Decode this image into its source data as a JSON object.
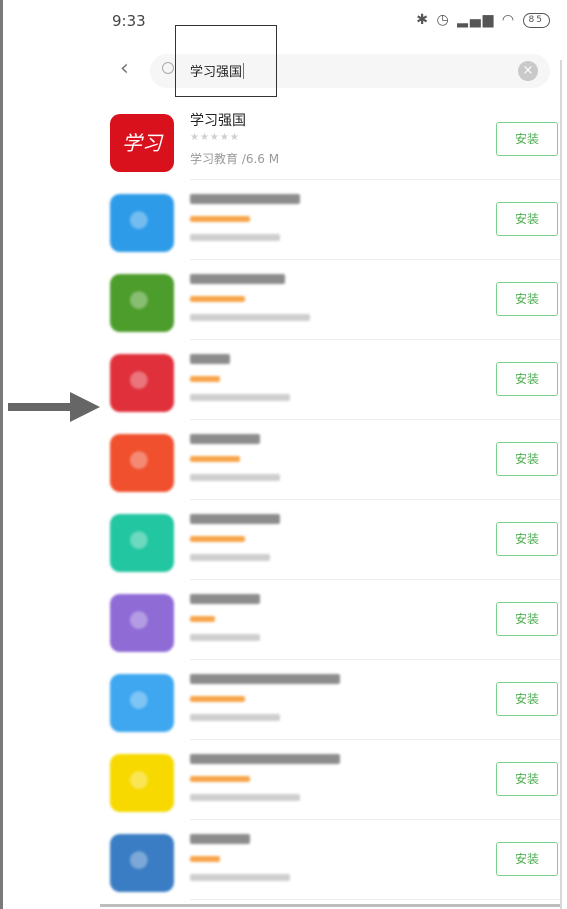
{
  "status": {
    "time": "9:33",
    "battery": "85"
  },
  "search": {
    "query": "学习强国"
  },
  "featured": {
    "name": "学习强国",
    "icon_text": "学习",
    "stars": "★★★★★",
    "meta": "学习教育 /6.6 M",
    "install_label": "安装"
  },
  "results": [
    {
      "icon_color": "#2e9be8",
      "install_label": "安装"
    },
    {
      "icon_color": "#4c9d2b",
      "install_label": "安装"
    },
    {
      "icon_color": "#e0303b",
      "install_label": "安装"
    },
    {
      "icon_color": "#f0502e",
      "install_label": "安装"
    },
    {
      "icon_color": "#22c6a0",
      "install_label": "安装"
    },
    {
      "icon_color": "#8f6bd6",
      "install_label": "安装"
    },
    {
      "icon_color": "#3ea7f0",
      "install_label": "安装"
    },
    {
      "icon_color": "#f7d900",
      "install_label": "安装"
    },
    {
      "icon_color": "#3a7dc4",
      "install_label": "安装"
    }
  ],
  "colors": {
    "accent": "#4caf50",
    "arrow": "#666666",
    "rating_bar": "#f7a54a"
  }
}
